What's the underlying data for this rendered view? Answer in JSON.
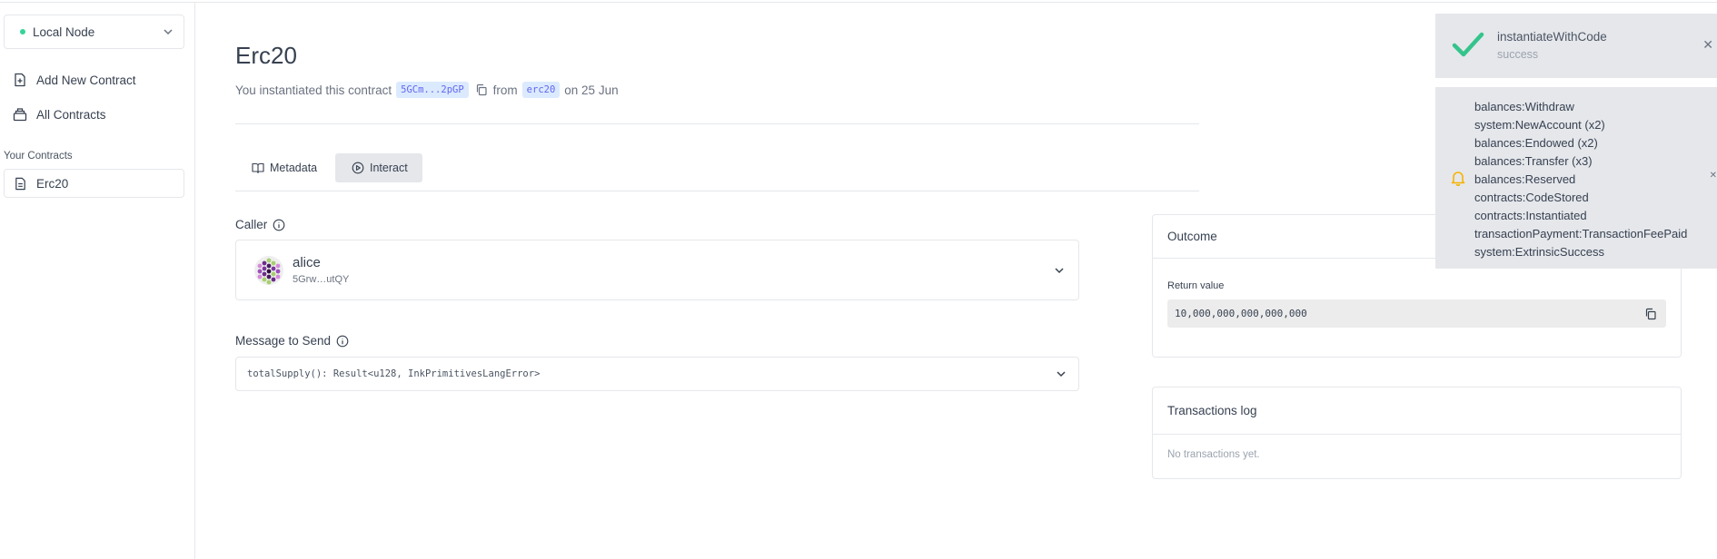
{
  "sidebar": {
    "node_label": "Local Node",
    "add_contract": "Add New Contract",
    "all_contracts": "All Contracts",
    "your_contracts_heading": "Your Contracts",
    "contracts": [
      "Erc20"
    ]
  },
  "header": {
    "title": "Erc20",
    "instantiated_prefix": "You instantiated this contract",
    "address_chip": "5GCm...2pGP",
    "from_text": "from",
    "code_chip": "erc20",
    "date_text": "on 25 Jun"
  },
  "tabs": [
    {
      "label": "Metadata"
    },
    {
      "label": "Interact"
    }
  ],
  "caller": {
    "label": "Caller",
    "name": "alice",
    "address": "5Grw…utQY"
  },
  "message": {
    "label": "Message to Send",
    "value": "totalSupply(): Result<u128, InkPrimitivesLangError>"
  },
  "outcome": {
    "title": "Outcome",
    "return_label": "Return value",
    "return_value": "10,000,000,000,000,000"
  },
  "tx_log": {
    "title": "Transactions log",
    "empty": "No transactions yet."
  },
  "toasts": {
    "success": {
      "title": "instantiateWithCode",
      "status": "success"
    },
    "events": [
      "balances:Withdraw",
      "system:NewAccount (x2)",
      "balances:Endowed (x2)",
      "balances:Transfer (x3)",
      "balances:Reserved",
      "contracts:CodeStored",
      "contracts:Instantiated",
      "transactionPayment:TransactionFeePaid",
      "system:ExtrinsicSuccess"
    ]
  },
  "colors": {
    "success_check": "#34c48b",
    "bell": "#f5b400",
    "chip_bg": "#dbeafe",
    "chip_text": "#6366f1",
    "node_dot": "#34d399"
  }
}
